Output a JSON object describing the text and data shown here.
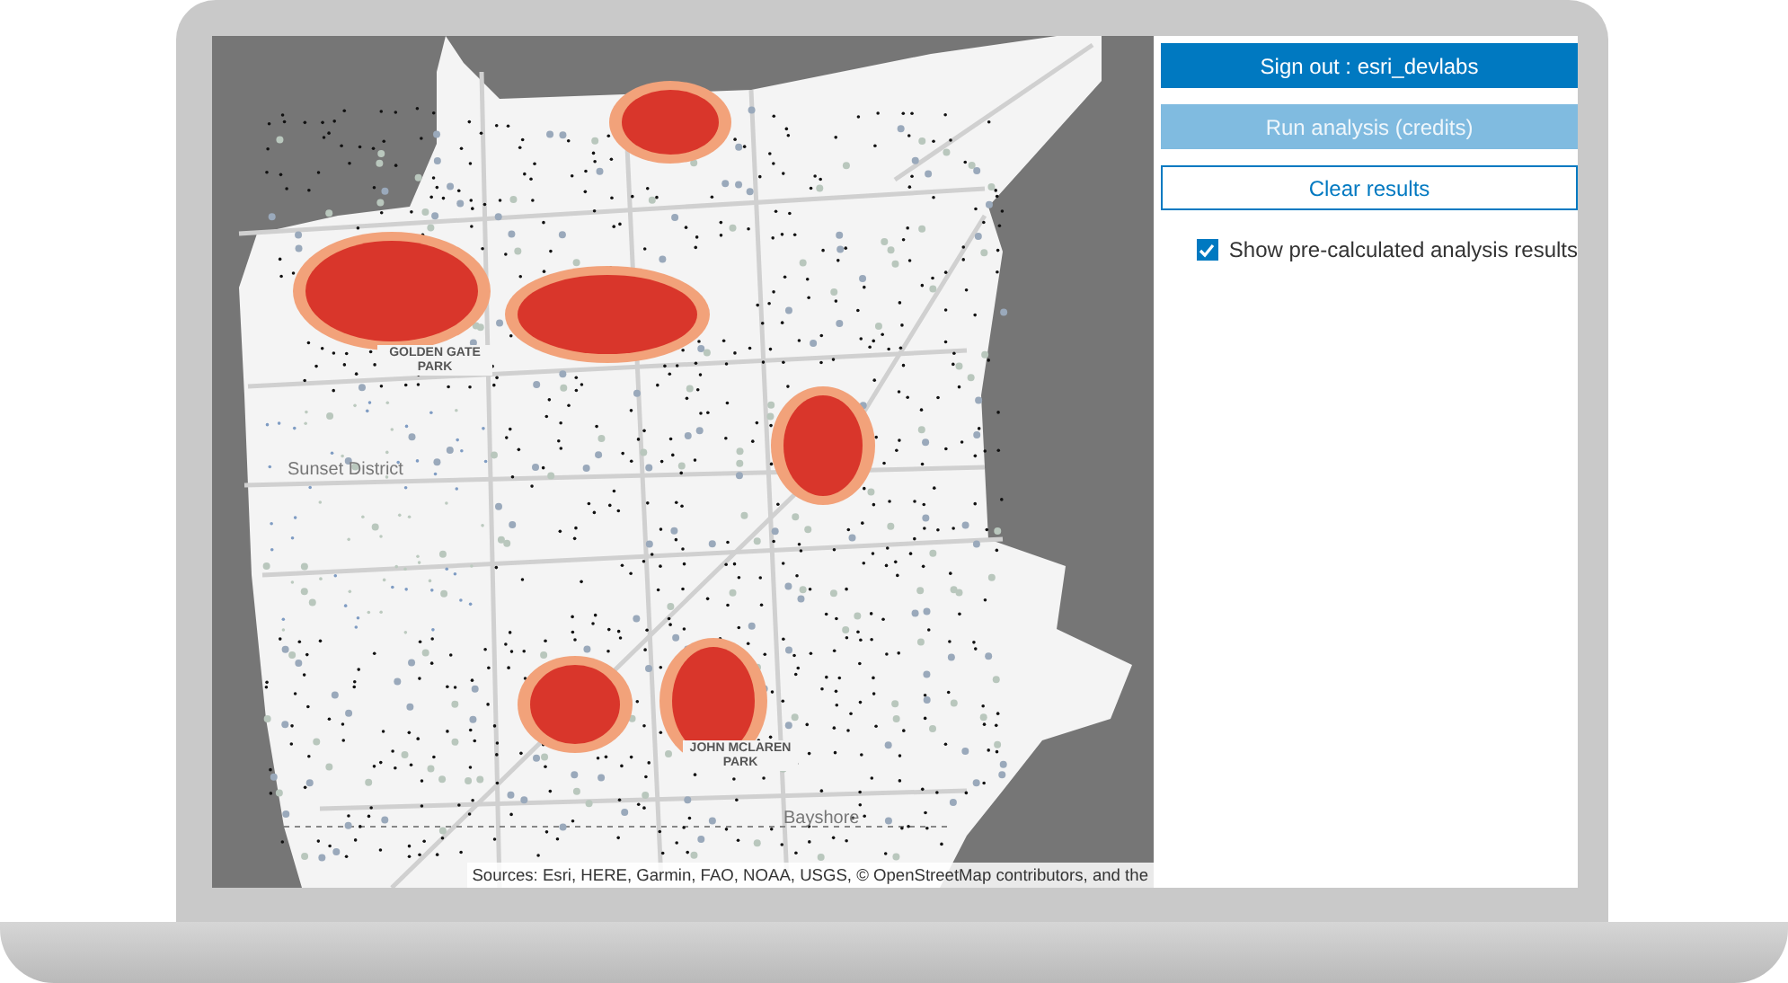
{
  "map": {
    "labels": [
      {
        "text": "GOLDEN GATE PARK",
        "kind": "park"
      },
      {
        "text": "Sunset District",
        "kind": "district"
      },
      {
        "text": "JOHN MCLAREN PARK",
        "kind": "park"
      },
      {
        "text": "Bayshore",
        "kind": "district"
      }
    ],
    "attribution": "Sources: Esri, HERE, Garmin, FAO, NOAA, USGS, © OpenStreetMap contributors, and the"
  },
  "buttons": [
    {
      "label": "Sign out : esri_devlabs",
      "kind": "primary",
      "disabled": false
    },
    {
      "label": "Run analysis (credits)",
      "kind": "primary",
      "disabled": true
    },
    {
      "label": "Clear results",
      "kind": "outline",
      "disabled": false
    }
  ],
  "checkbox": {
    "label": "Show pre-calculated analysis results",
    "checked": true
  }
}
